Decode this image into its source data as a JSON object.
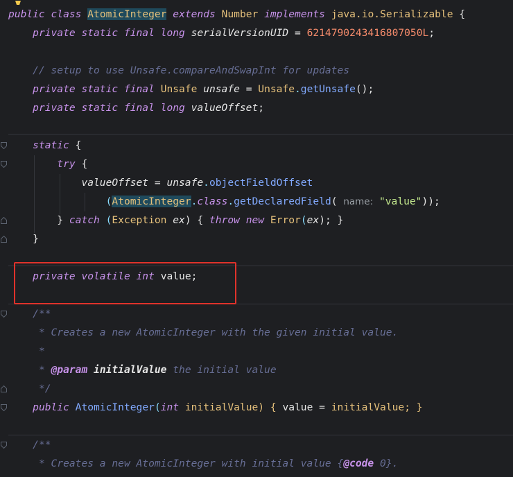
{
  "code": {
    "line1": {
      "public": "public",
      "class": "class",
      "name": "AtomicInteger",
      "extends": "extends",
      "number": "Number",
      "implements": "implements",
      "serializable": "java.io.Serializable",
      "brace": " {"
    },
    "line2": {
      "mods": "private static final long",
      "field": "serialVersionUID",
      "eq": " = ",
      "value": "6214790243416807050L",
      "semi": ";"
    },
    "line3": {
      "comment": "// setup to use Unsafe.compareAndSwapInt for updates"
    },
    "line4": {
      "mods": "private static final",
      "type": "Unsafe",
      "field": "unsafe",
      "eq": " = ",
      "cls": "Unsafe",
      "dot": ".",
      "method": "getUnsafe",
      "tail": "();"
    },
    "line5": {
      "mods": "private static final long",
      "field": "valueOffset",
      "semi": ";"
    },
    "line6": {
      "kw": "static",
      "brace": " {"
    },
    "line7": {
      "kw": "try",
      "brace": " {"
    },
    "line8": {
      "field": "valueOffset",
      "eq": " = ",
      "obj": "unsafe",
      "dot": ".",
      "method": "objectFieldOffset"
    },
    "line9": {
      "open": "(",
      "cls": "AtomicInteger",
      "dot": ".",
      "kw": "class",
      "dot2": ".",
      "method": "getDeclaredField",
      "paren": "( ",
      "hint": "name:",
      "str": "\"value\"",
      "tail": "));"
    },
    "line10": {
      "close": "} ",
      "kw": "catch",
      "open": " (",
      "exc": "Exception",
      "var": "ex",
      "close2": ") { ",
      "throw": "throw",
      "new": "new",
      "err": "Error",
      "open2": "(",
      "var2": "ex",
      "tail": "); }"
    },
    "line11": {
      "brace": "}"
    },
    "line12": {
      "mods": "private volatile int",
      "field": "value",
      "semi": ";"
    },
    "line13": {
      "text": "/**"
    },
    "line14": {
      "text": " * Creates a new AtomicInteger with the given initial value."
    },
    "line15": {
      "text": " *"
    },
    "line16": {
      "prefix": " * ",
      "tag": "@param",
      "param": "initialValue",
      "desc": " the initial value"
    },
    "line17": {
      "text": " */"
    },
    "line18": {
      "public": "public",
      "name": "AtomicInteger",
      "open": "(",
      "type": "int",
      "param": "initialValue",
      "close": ") { ",
      "field": "value",
      "eq": " = ",
      "val": "initialValue",
      "tail": "; }"
    },
    "line19": {
      "text": "/**"
    },
    "line20": {
      "prefix": " * Creates a new AtomicInteger with initial value ",
      "open": "{",
      "tag": "@code",
      "val": "0",
      "close": "}",
      "tail": "."
    }
  },
  "theme": {
    "background": "#1e1f22",
    "keyword": "#c792ea",
    "class": "#e5c07b",
    "comment": "#676e95",
    "number": "#f78c6c",
    "string": "#c3e88d",
    "method": "#82aaff",
    "highlight_box": "#e0322b"
  },
  "icons": [
    "lightbulb-icon",
    "fold-arrow-icon"
  ]
}
